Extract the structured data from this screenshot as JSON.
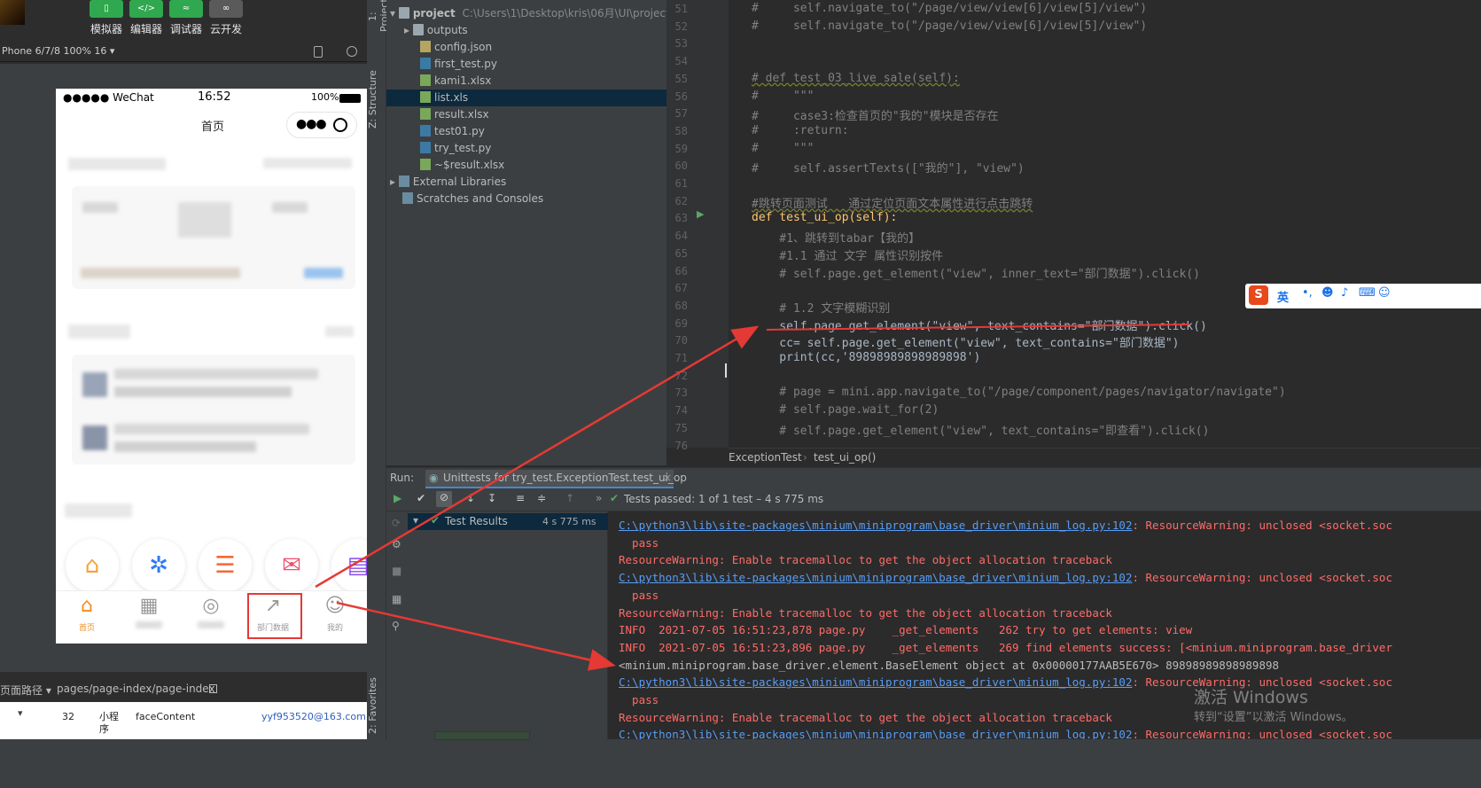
{
  "devtools": {
    "toolbar": [
      {
        "label": "模拟器",
        "icon": "phone-icon"
      },
      {
        "label": "编辑器",
        "icon": "code-icon"
      },
      {
        "label": "调试器",
        "icon": "sliders-icon"
      },
      {
        "label": "云开发",
        "icon": "cloud-link-icon"
      }
    ],
    "device_label": "Phone 6/7/8 100% 16 ▾",
    "path_label": "页面路径 ▾",
    "page_path": "pages/page-index/page-index",
    "table_row": [
      "32",
      "小程序",
      "faceContent",
      "yyf953520@163.com"
    ]
  },
  "phone": {
    "carrier": "●●●●● WeChat",
    "time": "16:52",
    "battery": "100%",
    "title": "首页",
    "tabs": [
      "首页",
      "",
      "",
      "部门数据",
      "我的"
    ]
  },
  "project": {
    "root": "project",
    "root_path": "C:\\Users\\1\\Desktop\\kris\\06月\\UI\\project",
    "items": [
      {
        "name": "outputs",
        "type": "folder"
      },
      {
        "name": "config.json",
        "type": "json"
      },
      {
        "name": "first_test.py",
        "type": "py"
      },
      {
        "name": "kami1.xlsx",
        "type": "xls"
      },
      {
        "name": "list.xls",
        "type": "xls"
      },
      {
        "name": "result.xlsx",
        "type": "xls"
      },
      {
        "name": "test01.py",
        "type": "py"
      },
      {
        "name": "try_test.py",
        "type": "py"
      },
      {
        "name": "~$result.xlsx",
        "type": "xls"
      }
    ],
    "external": "External Libraries",
    "scratches": "Scratches and Consoles"
  },
  "side_tabs": [
    "1: Project",
    "Z: Structure",
    "2: Favorites"
  ],
  "editor": {
    "lines": [
      {
        "n": "51",
        "t": "#     self.navigate_to(\"/page/view/view[6]/view[5]/view\")"
      },
      {
        "n": "52",
        "t": "#     self.navigate_to(\"/page/view/view[6]/view[5]/view\")"
      },
      {
        "n": "53",
        "t": ""
      },
      {
        "n": "54",
        "t": ""
      },
      {
        "n": "55",
        "t": "# def test_03_live_sale(self):"
      },
      {
        "n": "56",
        "t": "#     \"\"\""
      },
      {
        "n": "57",
        "t": "#     case3:检查首页的\"我的\"模块是否存在"
      },
      {
        "n": "58",
        "t": "#     :return:"
      },
      {
        "n": "59",
        "t": "#     \"\"\""
      },
      {
        "n": "60",
        "t": "#     self.assertTexts([\"我的\"], \"view\")"
      },
      {
        "n": "61",
        "t": ""
      },
      {
        "n": "62",
        "t": "#跳转页面测试   通过定位页面文本属性进行点击跳转"
      },
      {
        "n": "63",
        "t": "def test_ui_op(self):"
      },
      {
        "n": "64",
        "t": "    #1、跳转到tabar【我的】"
      },
      {
        "n": "65",
        "t": "    #1.1 通过 文字 属性识别按件"
      },
      {
        "n": "66",
        "t": "    # self.page.get_element(\"view\", inner_text=\"部门数据\").click()"
      },
      {
        "n": "67",
        "t": ""
      },
      {
        "n": "68",
        "t": "    # 1.2 文字模糊识别"
      },
      {
        "n": "69",
        "t": "    self.page.get_element(\"view\", text_contains=\"部门数据\").click()"
      },
      {
        "n": "70",
        "t": "    cc= self.page.get_element(\"view\", text_contains=\"部门数据\")"
      },
      {
        "n": "71",
        "t": "    print(cc,'89898989898989898')"
      },
      {
        "n": "72",
        "t": ""
      },
      {
        "n": "73",
        "t": "    # page = mini.app.navigate_to(\"/page/component/pages/navigator/navigate\")"
      },
      {
        "n": "74",
        "t": "    # self.page.wait_for(2)"
      },
      {
        "n": "75",
        "t": "    # self.page.get_element(\"view\", text_contains=\"即查看\").click()"
      },
      {
        "n": "76",
        "t": ""
      }
    ],
    "breadcrumb_class": "ExceptionTest",
    "breadcrumb_method": "test_ui_op()"
  },
  "run": {
    "label": "Run:",
    "tab": "Unittests for try_test.ExceptionTest.test_ui_op",
    "status": "Tests passed: 1 of 1 test – 4 s 775 ms",
    "tree_root": "Test Results",
    "tree_time": "4 s 775 ms"
  },
  "console": [
    {
      "kind": "link",
      "text": "C:\\python3\\lib\\site-packages\\minium\\miniprogram\\base_driver\\minium_log.py:102",
      "rest": ": ResourceWarning: unclosed <socket.soc"
    },
    {
      "kind": "err",
      "text": "  pass"
    },
    {
      "kind": "err",
      "text": "ResourceWarning: Enable tracemalloc to get the object allocation traceback"
    },
    {
      "kind": "link",
      "text": "C:\\python3\\lib\\site-packages\\minium\\miniprogram\\base_driver\\minium_log.py:102",
      "rest": ": ResourceWarning: unclosed <socket.soc"
    },
    {
      "kind": "err",
      "text": "  pass"
    },
    {
      "kind": "err",
      "text": "ResourceWarning: Enable tracemalloc to get the object allocation traceback"
    },
    {
      "kind": "err",
      "text": "INFO  2021-07-05 16:51:23,878 page.py    _get_elements   262 try to get elements: view"
    },
    {
      "kind": "err",
      "text": "INFO  2021-07-05 16:51:23,896 page.py    _get_elements   269 find elements success: [<minium.miniprogram.base_driver"
    },
    {
      "kind": "out",
      "text": "<minium.miniprogram.base_driver.element.BaseElement object at 0x00000177AAB5E670> 89898989898989898"
    },
    {
      "kind": "link",
      "text": "C:\\python3\\lib\\site-packages\\minium\\miniprogram\\base_driver\\minium_log.py:102",
      "rest": ": ResourceWarning: unclosed <socket.soc"
    },
    {
      "kind": "err",
      "text": "  pass"
    },
    {
      "kind": "err",
      "text": "ResourceWarning: Enable tracemalloc to get the object allocation traceback"
    },
    {
      "kind": "link",
      "text": "C:\\python3\\lib\\site-packages\\minium\\miniprogram\\base_driver\\minium_log.py:102",
      "rest": ": ResourceWarning: unclosed <socket.soc"
    }
  ],
  "ime": {
    "label": "英"
  },
  "watermark": {
    "title": "激活 Windows",
    "sub": "转到“设置”以激活 Windows。"
  },
  "colors": {
    "accent_red": "#e53935",
    "tab_active": "#f08c1f",
    "wechat_green": "#2fa84f"
  }
}
